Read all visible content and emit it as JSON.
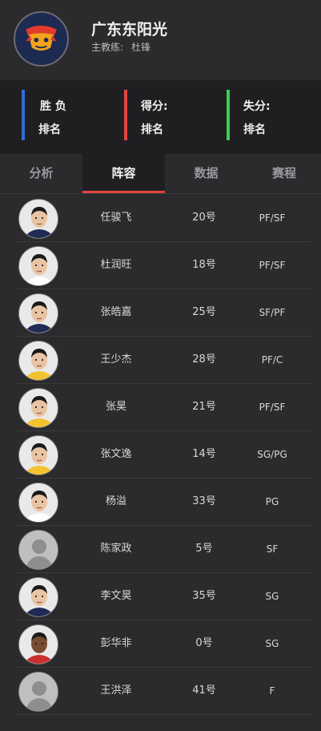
{
  "team": {
    "name": "广东东阳光",
    "coach_label": "主教练:",
    "coach_name": "杜锋"
  },
  "stats": [
    {
      "line1": "胜  负",
      "line2": "排名",
      "color": "#2e6fd6"
    },
    {
      "line1": "得分:",
      "line2": "排名",
      "color": "#e0463f"
    },
    {
      "line1": "失分:",
      "line2": "排名",
      "color": "#3ccf4e"
    }
  ],
  "tabs": [
    {
      "label": "分析",
      "active": false
    },
    {
      "label": "阵容",
      "active": true
    },
    {
      "label": "数据",
      "active": false
    },
    {
      "label": "赛程",
      "active": false
    }
  ],
  "roster": [
    {
      "name": "任骏飞",
      "number": "20号",
      "position": "PF/SF",
      "has_photo": true
    },
    {
      "name": "杜润旺",
      "number": "18号",
      "position": "PF/SF",
      "has_photo": true
    },
    {
      "name": "张皓嘉",
      "number": "25号",
      "position": "SF/PF",
      "has_photo": true
    },
    {
      "name": "王少杰",
      "number": "28号",
      "position": "PF/C",
      "has_photo": true
    },
    {
      "name": "张昊",
      "number": "21号",
      "position": "PF/SF",
      "has_photo": true
    },
    {
      "name": "张文逸",
      "number": "14号",
      "position": "SG/PG",
      "has_photo": true
    },
    {
      "name": "杨溢",
      "number": "33号",
      "position": "PG",
      "has_photo": true
    },
    {
      "name": "陈家政",
      "number": "5号",
      "position": "SF",
      "has_photo": false
    },
    {
      "name": "李文昊",
      "number": "35号",
      "position": "SG",
      "has_photo": true
    },
    {
      "name": "彭华非",
      "number": "0号",
      "position": "SG",
      "has_photo": true
    },
    {
      "name": "王洪泽",
      "number": "41号",
      "position": "F",
      "has_photo": false
    }
  ]
}
